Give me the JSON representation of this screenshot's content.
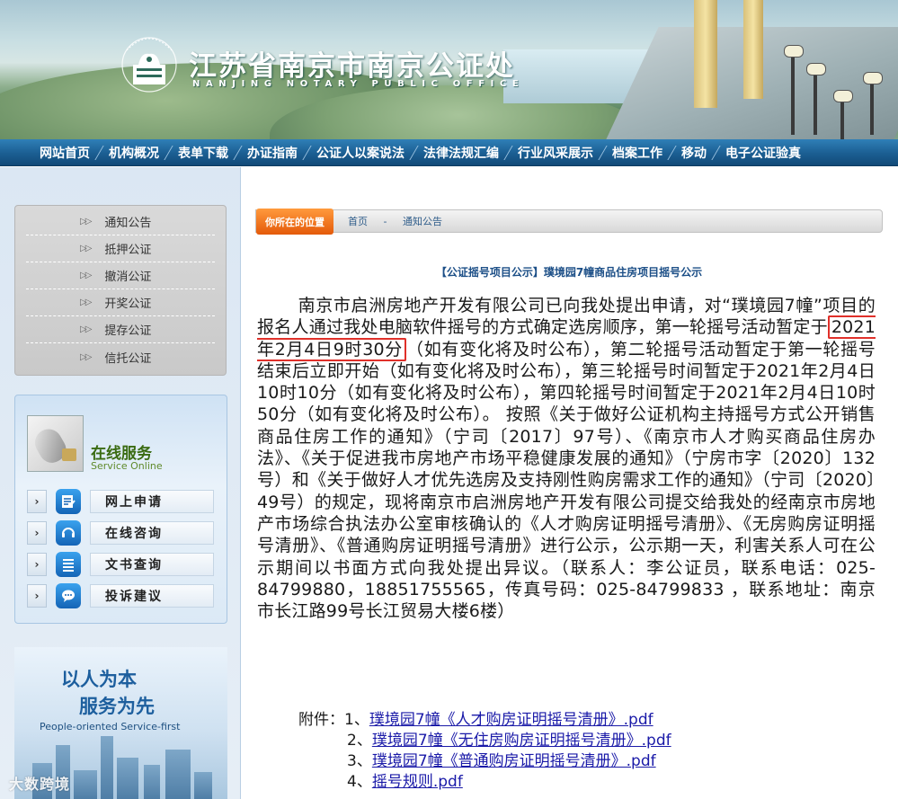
{
  "header": {
    "title": "江苏省南京市南京公证处",
    "subtitle": "NANJING NOTARY PUBLIC OFFICE",
    "logo_text": "NANJING NOTARY PUBLIC OFFICE"
  },
  "nav": {
    "items": [
      {
        "label": "网站首页"
      },
      {
        "label": "机构概况"
      },
      {
        "label": "表单下载"
      },
      {
        "label": "办证指南"
      },
      {
        "label": "公证人以案说法"
      },
      {
        "label": "法律法规汇编"
      },
      {
        "label": "行业风采展示"
      },
      {
        "label": "档案工作"
      },
      {
        "label": "移动"
      },
      {
        "label": "电子公证验真"
      }
    ]
  },
  "sidebar": {
    "notices": [
      {
        "label": "通知公告"
      },
      {
        "label": "抵押公证"
      },
      {
        "label": "撤消公证"
      },
      {
        "label": "开奖公证"
      },
      {
        "label": "提存公证"
      },
      {
        "label": "信托公证"
      }
    ],
    "service": {
      "title": "在线服务",
      "subtitle": "Service Online",
      "items": [
        {
          "label": "网上申请",
          "icon": "form-icon"
        },
        {
          "label": "在线咨询",
          "icon": "headset-icon"
        },
        {
          "label": "文书查询",
          "icon": "document-list-icon"
        },
        {
          "label": "投诉建议",
          "icon": "chat-bubble-icon"
        }
      ]
    },
    "slogan": {
      "line1": "以人为本",
      "line2": "服务为先",
      "english": "People-oriented  Service-first"
    }
  },
  "breadcrumb": {
    "tag": "你所在的位置",
    "home": "首页",
    "separator": "-",
    "current": "通知公告"
  },
  "article": {
    "title": "【公证摇号项目公示】璞境园7幢商品住房项目摇号公示",
    "body_before": "南京市启洲房地产开发有限公司已向我处提出申请，对“璞境园7幢”项目的报名人通过我处电脑软件摇号的方式确定选房顺序，第一轮摇号活动暂定于",
    "body_highlight": "2021年2月4日9时30分",
    "body_after": "（如有变化将及时公布），第二轮摇号活动暂定于第一轮摇号结束后立即开始（如有变化将及时公布），第三轮摇号时间暂定于2021年2月4日10时10分（如有变化将及时公布），第四轮摇号时间暂定于2021年2月4日10时50分（如有变化将及时公布）。 按照《关于做好公证机构主持摇号方式公开销售商品住房工作的通知》（宁司〔2017〕97号）、《南京市人才购买商品住房办法》、《关于促进我市房地产市场平稳健康发展的通知》（宁房市字〔2020〕132号）和《关于做好人才优先选房及支持刚性购房需求工作的通知》（宁司〔2020〕49号）的规定，现将南京市启洲房地产开发有限公司提交给我处的经南京市房地产市场综合执法办公室审核确认的《人才购房证明摇号清册》、《无房购房证明摇号清册》、《普通购房证明摇号清册》进行公示，公示期一天，利害关系人可在公示期间以书面方式向我处提出异议。（联系人：李公证员，联系电话：025-84799880，18851755565，传真号码：025-84799833 ，联系地址：南京市长江路99号长江贸易大楼6楼）",
    "attachments_label": "附件：",
    "attachments": [
      {
        "num": "1、",
        "name": "璞境园7幢《人才购房证明摇号清册》.pdf"
      },
      {
        "num": "2、",
        "name": "璞境园7幢《无住房购房证明摇号清册》.pdf"
      },
      {
        "num": "3、",
        "name": "璞境园7幢《普通购房证明摇号清册》.pdf"
      },
      {
        "num": "4、",
        "name": "摇号规则.pdf"
      }
    ]
  },
  "watermark": "大数跨境",
  "colors": {
    "nav_bg": "#1b5e92",
    "highlight_border": "#e0302a",
    "link": "#1a1aa8",
    "title_blue": "#1c4f87",
    "tag_orange": "#e45a0a"
  }
}
